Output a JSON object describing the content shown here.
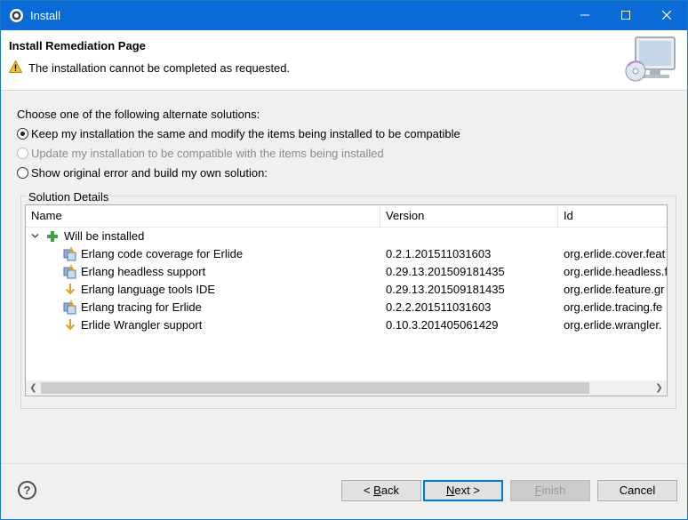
{
  "window": {
    "title": "Install"
  },
  "header": {
    "heading": "Install Remediation Page",
    "message": "The installation cannot be completed as requested."
  },
  "options": {
    "prompt": "Choose one of the following alternate solutions:",
    "choices": [
      {
        "label": "Keep my installation the same and modify the items being installed to be compatible",
        "selected": true,
        "enabled": true
      },
      {
        "label": "Update my installation to be compatible with the items being installed",
        "selected": false,
        "enabled": false
      },
      {
        "label": "Show original error and build my own solution:",
        "selected": false,
        "enabled": true
      }
    ]
  },
  "details": {
    "legend": "Solution Details",
    "columns": [
      "Name",
      "Version",
      "Id"
    ],
    "group": {
      "label": "Will be installed",
      "icon": "plus-icon"
    },
    "rows": [
      {
        "name": "Erlang code coverage for Erlide",
        "version": "0.2.1.201511031603",
        "id": "org.erlide.cover.feat",
        "icon": "feature-group-icon"
      },
      {
        "name": "Erlang headless support",
        "version": "0.29.13.201509181435",
        "id": "org.erlide.headless.f",
        "icon": "feature-group-icon"
      },
      {
        "name": "Erlang language tools IDE",
        "version": "0.29.13.201509181435",
        "id": "org.erlide.feature.gr",
        "icon": "install-arrow-icon"
      },
      {
        "name": "Erlang tracing for Erlide",
        "version": "0.2.2.201511031603",
        "id": "org.erlide.tracing.fe",
        "icon": "feature-group-icon"
      },
      {
        "name": "Erlide Wrangler support",
        "version": "0.10.3.201405061429",
        "id": "org.erlide.wrangler.",
        "icon": "install-arrow-icon"
      }
    ]
  },
  "buttons": {
    "back": {
      "prefix": "< ",
      "mnemonic": "B",
      "rest": "ack"
    },
    "next": {
      "mnemonic": "N",
      "rest": "ext >"
    },
    "finish": {
      "mnemonic": "F",
      "rest": "inish"
    },
    "cancel": "Cancel"
  }
}
